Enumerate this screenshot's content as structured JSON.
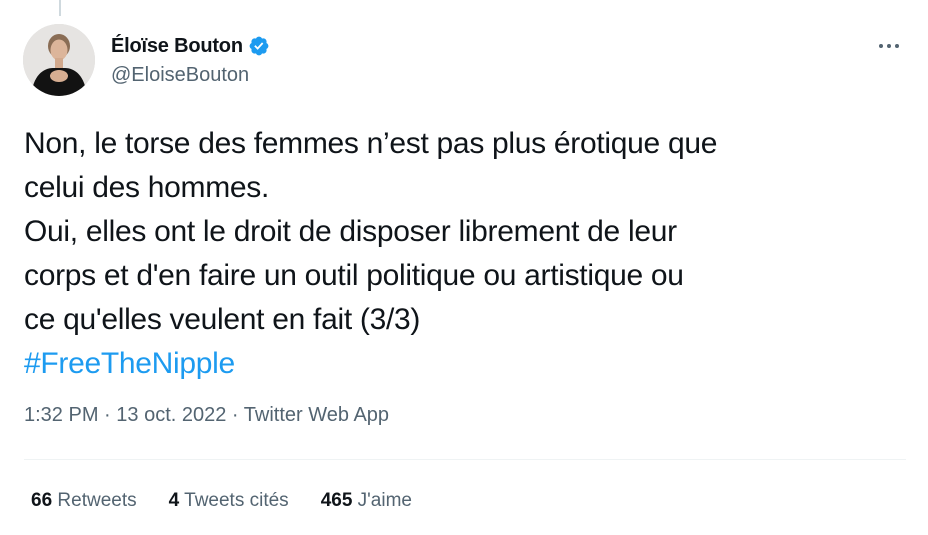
{
  "author": {
    "display_name": "Éloïse Bouton",
    "handle": "@EloiseBouton",
    "verified": true,
    "avatar_icon": "profile-photo",
    "verified_icon": "verified-badge-icon"
  },
  "tweet": {
    "lines": [
      "Non, le torse des femmes n’est pas plus érotique que",
      "celui des hommes.",
      "Oui, elles ont le droit de disposer librement de leur",
      "corps et d'en faire un outil politique ou artistique ou",
      "ce qu'elles veulent en fait (3/3)"
    ],
    "hashtag": "#FreeTheNipple"
  },
  "meta": {
    "time": "1:32 PM",
    "separator": " · ",
    "date": "13 oct. 2022",
    "source": "Twitter Web App"
  },
  "stats": {
    "retweets_count": "66",
    "retweets_label": "Retweets",
    "quotes_count": "4",
    "quotes_label": "Tweets cités",
    "likes_count": "465",
    "likes_label": "J'aime"
  },
  "colors": {
    "accent": "#1d9bf0",
    "text": "#0f1419",
    "secondary": "#536471",
    "divider": "#eff3f4"
  }
}
